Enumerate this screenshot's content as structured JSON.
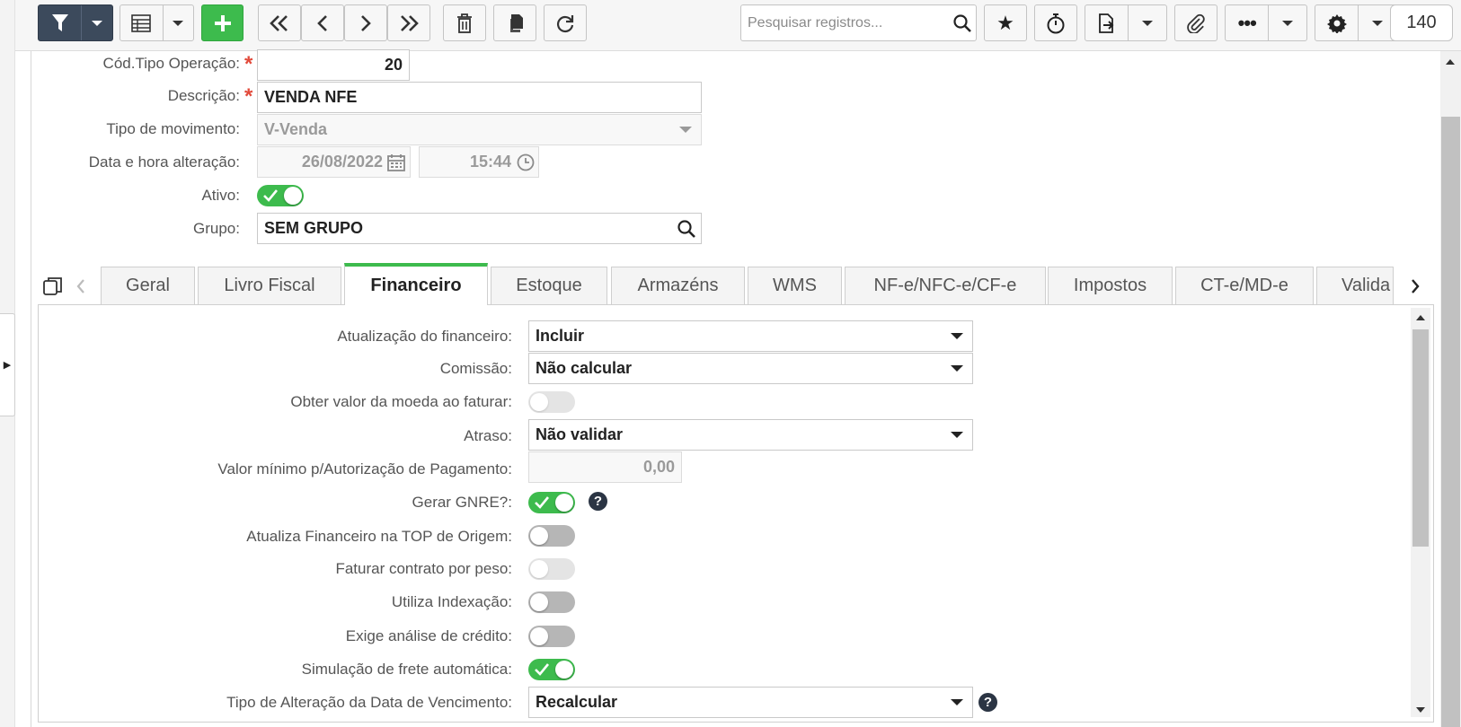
{
  "toolbar": {
    "search_placeholder": "Pesquisar registros...",
    "record_count": "140",
    "icons": [
      "filter-icon",
      "grid-icon",
      "add-icon",
      "first-icon",
      "previous-icon",
      "next-icon",
      "last-icon",
      "trash-icon",
      "copy-icon",
      "refresh-icon",
      "search-icon",
      "star-icon",
      "stopwatch-icon",
      "export-icon",
      "attach-icon",
      "more-icon",
      "gear-icon"
    ]
  },
  "header_form": {
    "cod_tipo_label": "Cód.Tipo Operação:",
    "cod_tipo_value": "20",
    "descricao_label": "Descrição:",
    "descricao_value": "VENDA NFE",
    "tipo_mov_label": "Tipo de movimento:",
    "tipo_mov_value": "V-Venda",
    "data_hora_label": "Data e hora alteração:",
    "data_value": "26/08/2022",
    "hora_value": "15:44",
    "ativo_label": "Ativo:",
    "ativo_on": true,
    "grupo_label": "Grupo:",
    "grupo_value": "SEM GRUPO"
  },
  "tabs": [
    "Geral",
    "Livro Fiscal",
    "Financeiro",
    "Estoque",
    "Armazéns",
    "WMS",
    "NF-e/NFC-e/CF-e",
    "Impostos",
    "CT-e/MD-e",
    "Valida"
  ],
  "active_tab": "Financeiro",
  "financeiro": {
    "atualizacao_label": "Atualização do financeiro:",
    "atualizacao_value": "Incluir",
    "comissao_label": "Comissão:",
    "comissao_value": "Não calcular",
    "obter_moeda_label": "Obter valor da moeda ao faturar:",
    "atraso_label": "Atraso:",
    "atraso_value": "Não validar",
    "valor_minimo_label": "Valor mínimo p/Autorização de Pagamento:",
    "valor_minimo_value": "0,00",
    "gerar_gnre_label": "Gerar GNRE?:",
    "atualiza_top_label": "Atualiza Financeiro na TOP de Origem:",
    "faturar_peso_label": "Faturar contrato por peso:",
    "utiliza_index_label": "Utiliza Indexação:",
    "exige_credito_label": "Exige análise de crédito:",
    "simulacao_frete_label": "Simulação de frete automática:",
    "tipo_alteracao_label": "Tipo de Alteração da Data de Vencimento:",
    "tipo_alteracao_value": "Recalcular",
    "help_glyph": "?"
  },
  "colors": {
    "accent_green": "#3dbb4d",
    "filter_dark": "#3c4a5c",
    "required_red": "#e24a3b"
  }
}
